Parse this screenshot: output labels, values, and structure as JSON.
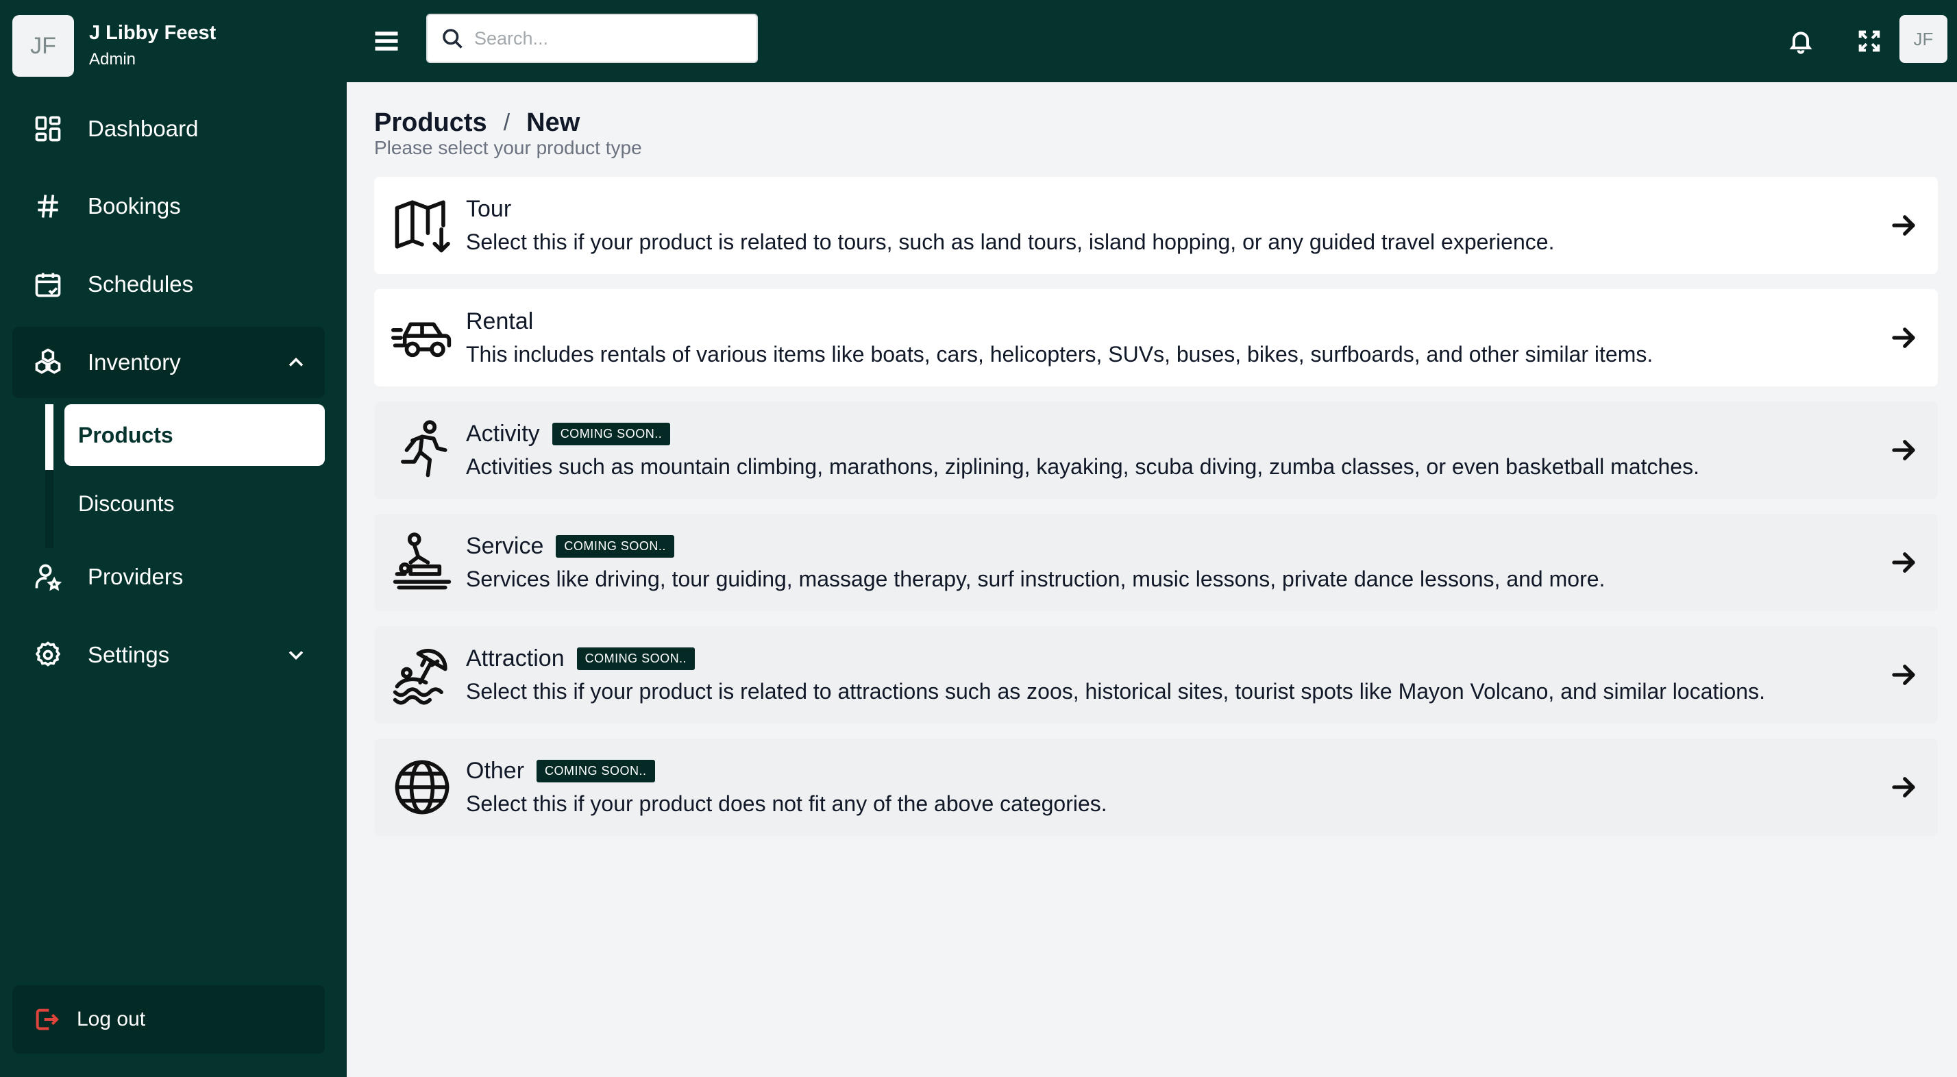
{
  "user": {
    "initials": "JF",
    "name": "J Libby Feest",
    "role": "Admin"
  },
  "sidebar": {
    "items": [
      {
        "label": "Dashboard",
        "icon": "grid-icon"
      },
      {
        "label": "Bookings",
        "icon": "hash-icon"
      },
      {
        "label": "Schedules",
        "icon": "calendar-check-icon"
      },
      {
        "label": "Inventory",
        "icon": "boxes-icon",
        "expanded": true
      },
      {
        "label": "Providers",
        "icon": "user-star-icon"
      },
      {
        "label": "Settings",
        "icon": "gear-icon",
        "expanded": false
      }
    ],
    "inventory_sub": [
      {
        "label": "Products",
        "active": true
      },
      {
        "label": "Discounts",
        "active": false
      }
    ],
    "logout_label": "Log out"
  },
  "topbar": {
    "search_placeholder": "Search...",
    "avatar_initials": "JF"
  },
  "page": {
    "breadcrumb": [
      "Products",
      "New"
    ],
    "separator": "/",
    "subtitle": "Please select your product type"
  },
  "product_types": [
    {
      "title": "Tour",
      "badge": "",
      "desc": "Select this if your product is related to tours, such as land tours, island hopping, or any guided travel experience.",
      "icon": "map-icon",
      "enabled": true
    },
    {
      "title": "Rental",
      "badge": "",
      "desc": "This includes rentals of various items like boats, cars, helicopters, SUVs, buses, bikes, surfboards, and other similar items.",
      "icon": "car-icon",
      "enabled": true
    },
    {
      "title": "Activity",
      "badge": "COMING SOON..",
      "desc": "Activities such as mountain climbing, marathons, ziplining, kayaking, scuba diving, zumba classes, or even basketball matches.",
      "icon": "running-icon",
      "enabled": false
    },
    {
      "title": "Service",
      "badge": "COMING SOON..",
      "desc": "Services like driving, tour guiding, massage therapy, surf instruction, music lessons, private dance lessons, and more.",
      "icon": "massage-icon",
      "enabled": false
    },
    {
      "title": "Attraction",
      "badge": "COMING SOON..",
      "desc": "Select this if your product is related to attractions such as zoos, historical sites, tourist spots like Mayon Volcano, and similar locations.",
      "icon": "beach-icon",
      "enabled": false
    },
    {
      "title": "Other",
      "badge": "COMING SOON..",
      "desc": "Select this if your product does not fit any of the above categories.",
      "icon": "globe-icon",
      "enabled": false
    }
  ],
  "colors": {
    "primary": "#05342e",
    "sidebar_dark": "#032a25",
    "logout_icon": "#e0453b",
    "page_bg": "#f3f4f6"
  }
}
